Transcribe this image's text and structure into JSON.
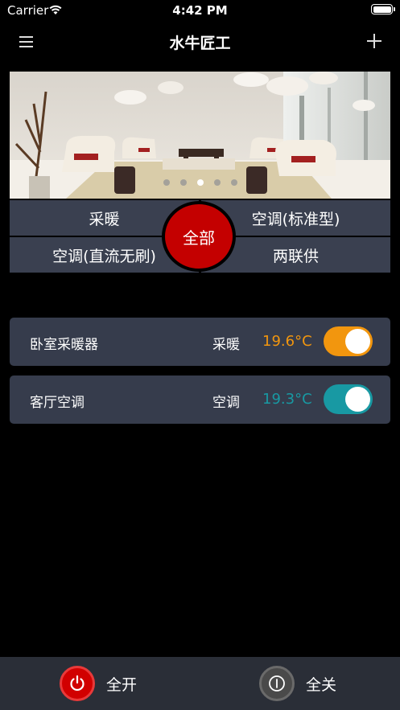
{
  "status_bar": {
    "carrier": "Carrier",
    "time": "4:42 PM"
  },
  "nav": {
    "title": "水牛匠工",
    "menu_icon": "hamburger-menu-icon",
    "add_icon": "plus-icon"
  },
  "banner": {
    "page_count": 5,
    "active_index": 2
  },
  "categories": {
    "heating": "采暖",
    "ac_standard": "空调(标准型)",
    "ac_dc": "空调(直流无刷)",
    "dual_supply": "两联供",
    "all": "全部"
  },
  "devices": [
    {
      "name": "卧室采暖器",
      "type": "采暖",
      "temp": "19.6°C",
      "on": true,
      "color": "#f2960e"
    },
    {
      "name": "客厅空调",
      "type": "空调",
      "temp": "19.3°C",
      "on": true,
      "color": "#1899a3"
    }
  ],
  "bottom": {
    "all_on": "全开",
    "all_off": "全关"
  },
  "colors": {
    "accent_red": "#c40000",
    "card_bg": "#363c4c",
    "category_bg": "#3a4050"
  }
}
